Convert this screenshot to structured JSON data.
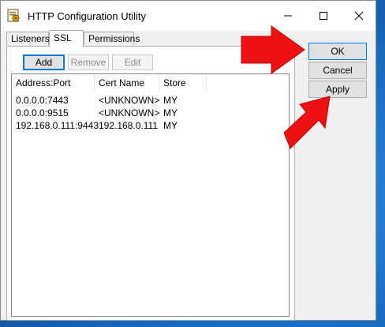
{
  "window": {
    "title": "HTTP Configuration Utility",
    "controls": {
      "minimize": "minimize",
      "maximize": "maximize",
      "close": "close"
    }
  },
  "tabs": [
    {
      "label": "Listeners"
    },
    {
      "label": "SSL"
    },
    {
      "label": "Permissions"
    }
  ],
  "toolbar": {
    "add": "Add",
    "remove": "Remove",
    "edit": "Edit"
  },
  "list": {
    "columns": [
      "Address:Port",
      "Cert Name",
      "Store"
    ],
    "rows": [
      [
        "0.0.0.0:7443",
        "<UNKNOWN>",
        "MY"
      ],
      [
        "0.0.0.0:9515",
        "<UNKNOWN>",
        "MY"
      ],
      [
        "192.168.0.111:9443",
        "192.168.0.111",
        "MY"
      ]
    ]
  },
  "dialog_buttons": {
    "ok": "OK",
    "cancel": "Cancel",
    "apply": "Apply"
  },
  "colors": {
    "arrow": "#ee1111",
    "desktop": "#1a6fc4",
    "focus": "#0a78d7"
  }
}
